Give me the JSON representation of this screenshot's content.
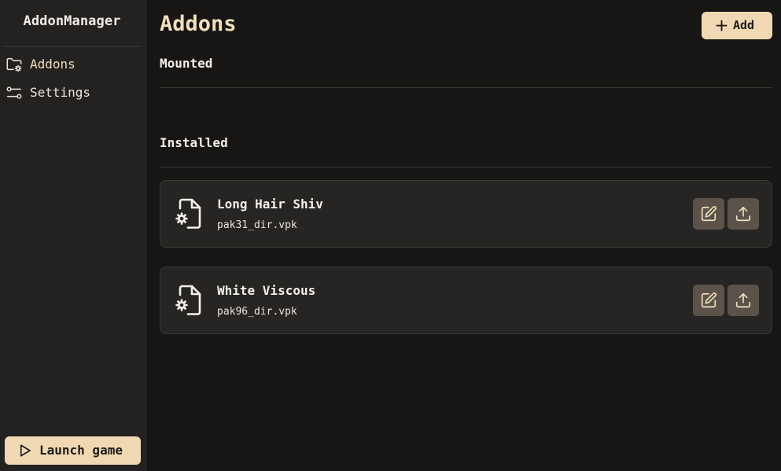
{
  "sidebar": {
    "app_title": "AddonManager",
    "items": [
      {
        "label": "Addons",
        "icon": "folder-gear-icon",
        "active": true
      },
      {
        "label": "Settings",
        "icon": "sliders-icon",
        "active": false
      }
    ],
    "launch_label": "Launch game"
  },
  "main": {
    "title": "Addons",
    "add_label": "Add",
    "sections": {
      "mounted": {
        "heading": "Mounted"
      },
      "installed": {
        "heading": "Installed"
      }
    },
    "addons": [
      {
        "name": "Long Hair Shiv",
        "file": "pak31_dir.vpk",
        "icon": "file-gear-icon"
      },
      {
        "name": "White Viscous",
        "file": "pak96_dir.vpk",
        "icon": "file-gear-icon"
      }
    ]
  },
  "colors": {
    "accent": "#f0d9b2",
    "accent_text": "#f3dfba",
    "background": "#171615",
    "sidebar": "#232221",
    "card": "#262524",
    "icon_button": "#5b5249"
  }
}
